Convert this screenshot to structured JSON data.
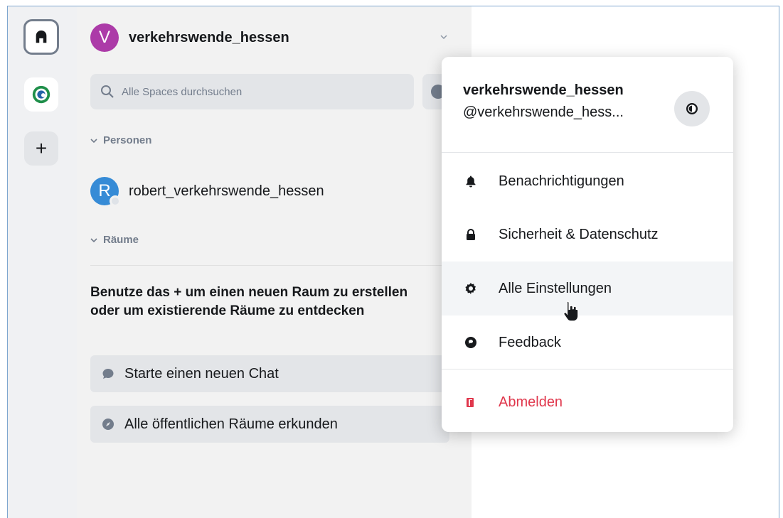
{
  "space_rail": {
    "home_icon": "home-icon",
    "space_icon": "space-logo",
    "add_label": "+"
  },
  "panel": {
    "space_avatar_letter": "V",
    "space_name": "verkehrswende_hessen",
    "search_placeholder": "Alle Spaces durchsuchen",
    "sections": {
      "people": "Personen",
      "rooms": "Räume"
    },
    "people": [
      {
        "avatar_letter": "R",
        "name": "robert_verkehrswende_hessen",
        "avatar_color": "#368bd6"
      }
    ],
    "empty_rooms_hint": "Benutze das + um einen neuen Raum zu erstellen oder um existierende Räume zu entdecken",
    "actions": {
      "new_chat": "Starte einen neuen Chat",
      "explore_rooms": "Alle öffentlichen Räume erkunden"
    }
  },
  "menu": {
    "user_name": "verkehrswende_hessen",
    "user_handle": "@verkehrswende_hess...",
    "items": {
      "notifications": "Benachrichtigungen",
      "security": "Sicherheit & Datenschutz",
      "all_settings": "Alle Einstellungen",
      "feedback": "Feedback",
      "logout": "Abmelden"
    }
  },
  "colors": {
    "space_avatar": "#ac3ba8",
    "logout": "#e0374c",
    "accent_muted": "#737d8c"
  }
}
